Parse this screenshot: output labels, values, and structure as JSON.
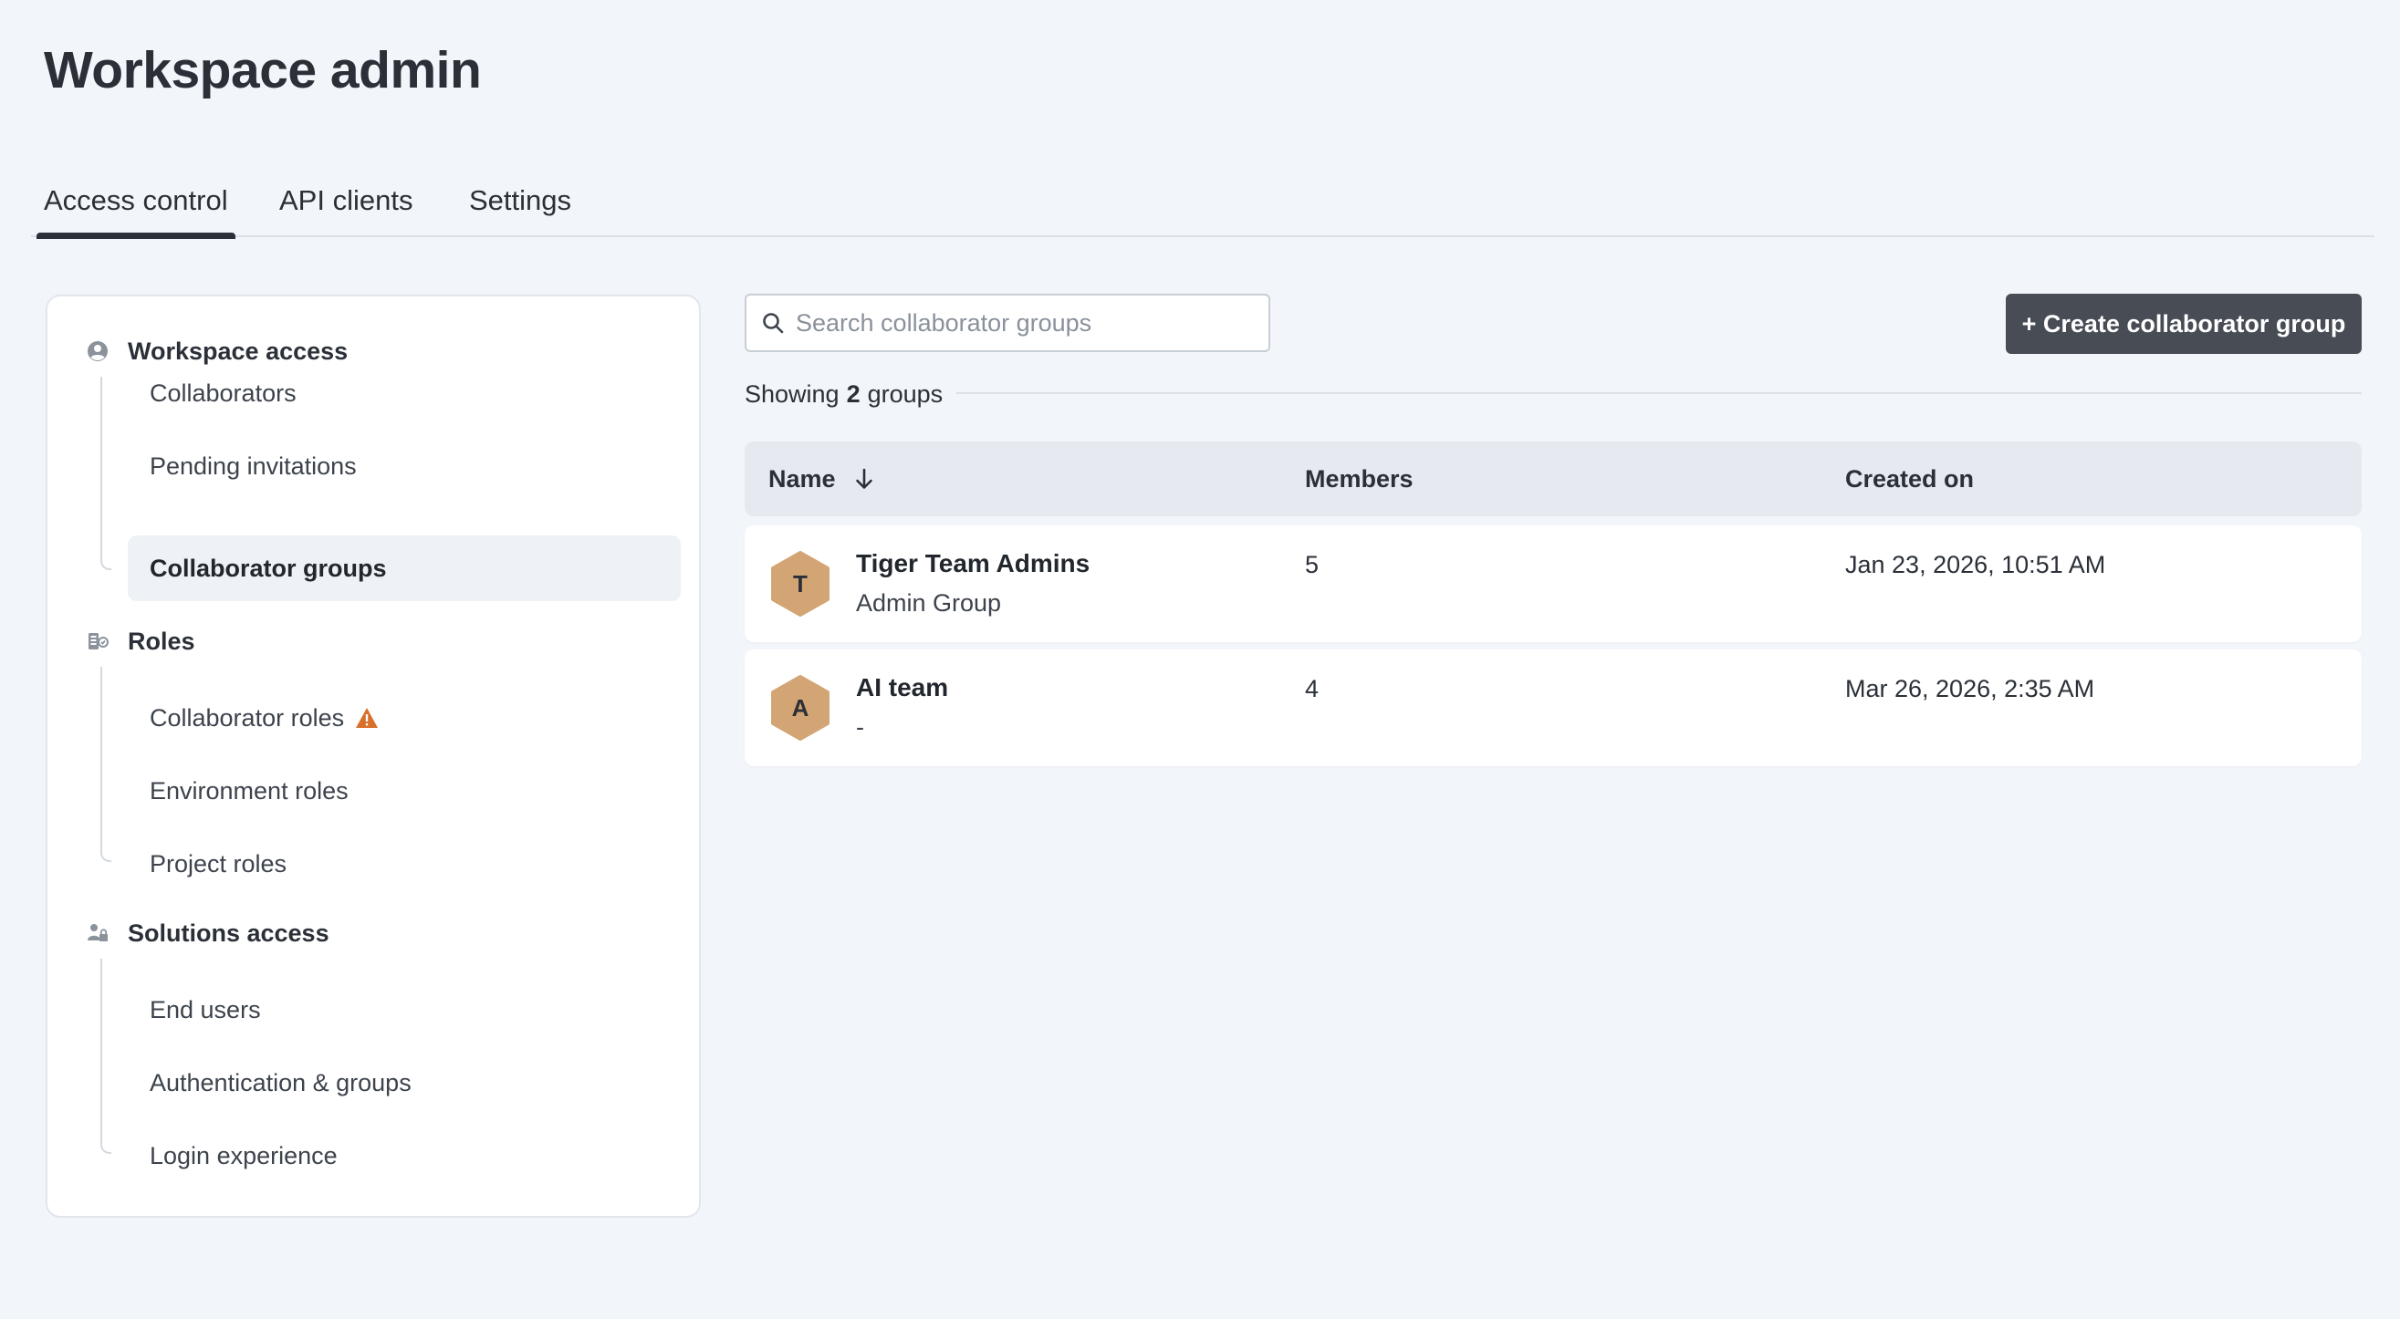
{
  "page": {
    "title": "Workspace admin"
  },
  "tabs": [
    {
      "label": "Access control",
      "active": true
    },
    {
      "label": "API clients",
      "active": false
    },
    {
      "label": "Settings",
      "active": false
    }
  ],
  "sidebar": {
    "sections": [
      {
        "title": "Workspace access",
        "icon": "user-circle-icon",
        "items": [
          {
            "label": "Collaborators"
          },
          {
            "label": "Pending invitations"
          },
          {
            "label": "Collaborator groups",
            "active": true
          }
        ]
      },
      {
        "title": "Roles",
        "icon": "roles-icon",
        "items": [
          {
            "label": "Collaborator roles",
            "warning": true
          },
          {
            "label": "Environment roles"
          },
          {
            "label": "Project roles"
          }
        ]
      },
      {
        "title": "Solutions access",
        "icon": "user-lock-icon",
        "items": [
          {
            "label": "End users"
          },
          {
            "label": "Authentication & groups"
          },
          {
            "label": "Login experience"
          }
        ]
      }
    ]
  },
  "search": {
    "placeholder": "Search collaborator groups",
    "value": ""
  },
  "create_button": {
    "label": "+ Create collaborator group"
  },
  "summary": {
    "prefix": "Showing",
    "count": "2",
    "suffix": "groups"
  },
  "table": {
    "columns": [
      "Name",
      "Members",
      "Created on"
    ],
    "rows": [
      {
        "initial": "T",
        "name": "Tiger Team Admins",
        "subtitle": "Admin Group",
        "members": "5",
        "created": "Jan 23, 2026, 10:51 AM"
      },
      {
        "initial": "A",
        "name": "AI team",
        "subtitle": "-",
        "members": "4",
        "created": "Mar 26, 2026, 2:35 AM"
      }
    ]
  },
  "colors": {
    "primary_button": "#474c55",
    "avatar": "#d4a574",
    "warning": "#d9702a",
    "background": "#f2f5f9"
  }
}
